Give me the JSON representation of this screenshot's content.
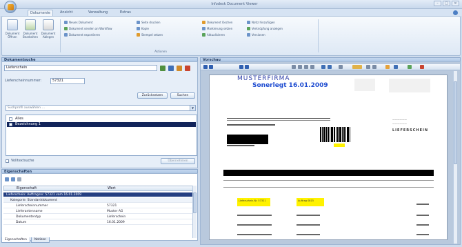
{
  "window": {
    "title": "Infodesk Document Viewer"
  },
  "ribbon": {
    "tabs": [
      {
        "label": "Dokumente",
        "active": true
      },
      {
        "label": "Ansicht",
        "active": false
      },
      {
        "label": "Verwaltung",
        "active": false
      },
      {
        "label": "Extras",
        "active": false
      }
    ],
    "big_buttons": [
      "Dokument Öffnen",
      "Dokument Bearbeiten",
      "Dokument Ablegen"
    ],
    "group_items": [
      [
        "Neues Dokument",
        "Dokument senden an Workflow",
        "Dokument exportieren"
      ],
      [
        "Seite drucken",
        "Kopie",
        "Stempel setzen"
      ],
      [
        "Dokument löschen",
        "Markierung setzen",
        "Aktualisieren"
      ],
      [
        "Notiz hinzufügen",
        "Verknüpfung anzeigen",
        "Versionen"
      ]
    ],
    "group_label": "Aktionen"
  },
  "left_panel": {
    "header": "Dokumentsuche",
    "search_value": "Lieferschein",
    "field_label": "Lieferscheinnummer:",
    "field_value": "57321",
    "buttons": [
      "Zurücksetzen",
      "Suchen"
    ],
    "combo_placeholder": "Suchprofil auswählen …",
    "list_items": [
      {
        "label": "Alles",
        "selected": false
      },
      {
        "label": "Bezeichnung 1",
        "selected": true
      }
    ],
    "checkbox_label": "Volltextsuche",
    "apply_button": "Übernehmen"
  },
  "properties_panel": {
    "header": "Eigenschaften",
    "columns": [
      "Eigenschaft",
      "Wert"
    ],
    "rows": [
      {
        "name": "Lieferschein: Auftragsnr. 57321 vom 16.01.2009",
        "value": "",
        "selected": true
      },
      {
        "name": "Kategorie: Standarddokument",
        "value": "",
        "sub": true
      },
      {
        "name": "Lieferscheinnummer",
        "value": "57321"
      },
      {
        "name": "Lieferantenname",
        "value": "Muster AG"
      },
      {
        "name": "Dokumententyp",
        "value": "Lieferschein"
      },
      {
        "name": "Datum",
        "value": "16.01.2009"
      }
    ],
    "bottom_tabs": [
      "Eigenschaften",
      "Notizen"
    ]
  },
  "viewer": {
    "header": "Vorschau",
    "document": {
      "logo": "MUSTERFIRMA",
      "title": "Sonerlegt 16.01.2009",
      "barcode_text": "LIEFERSCHEIN",
      "highlight_1": "Lieferschein-Nr. 57321",
      "highlight_2": "Auftrag 0815"
    }
  }
}
